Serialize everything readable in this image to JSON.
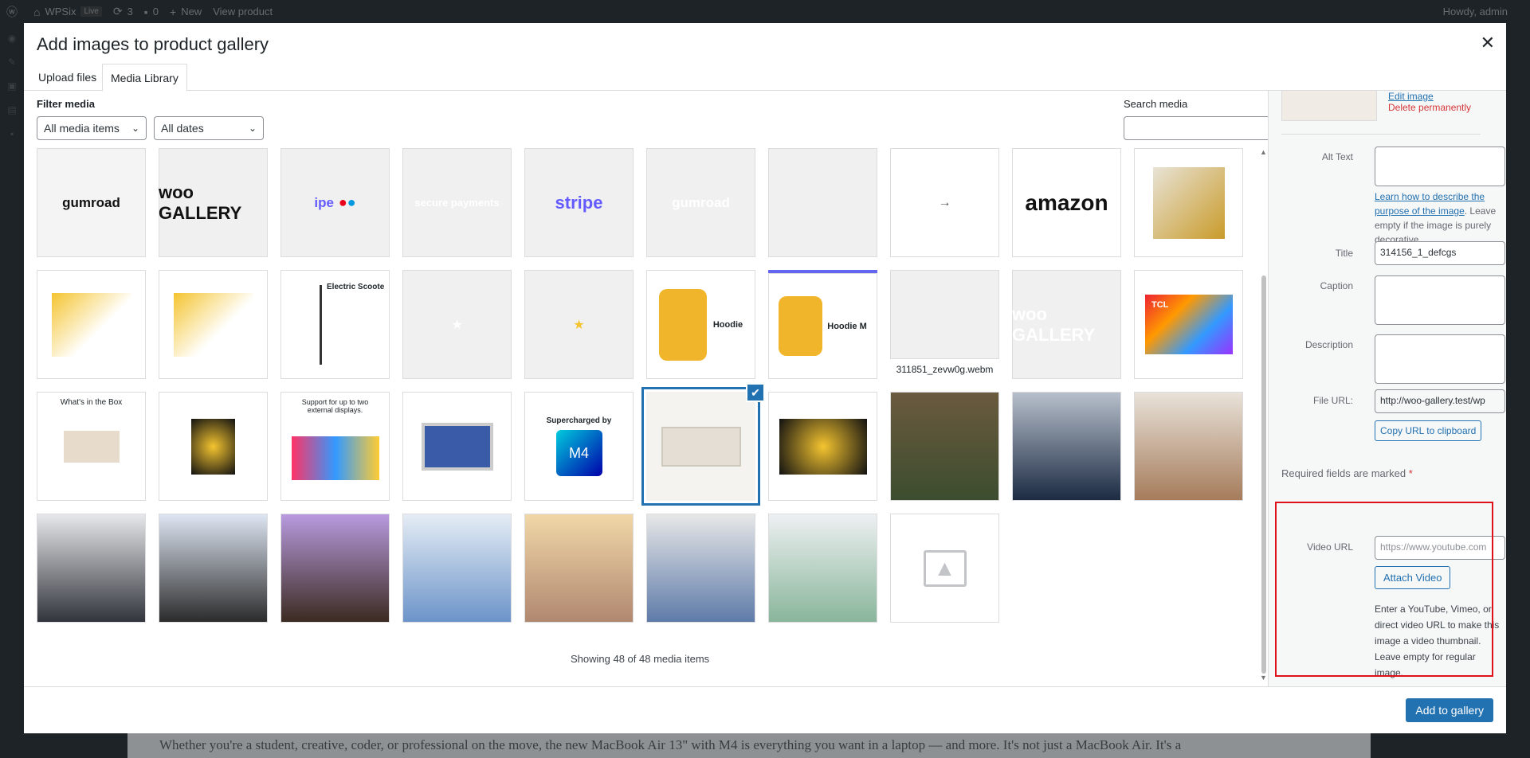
{
  "adminbar": {
    "site": "WPSix",
    "live": "Live",
    "updates": "3",
    "comments": "0",
    "new": "New",
    "view_product": "View product",
    "howdy": "Howdy, admin"
  },
  "modal": {
    "title": "Add images to product gallery",
    "tabs": [
      {
        "label": "Upload files"
      },
      {
        "label": "Media Library"
      }
    ],
    "filter_label": "Filter media",
    "filter_type": "All media items",
    "filter_date": "All dates",
    "search_label": "Search media",
    "showing": "Showing 48 of 48 media items",
    "tile_caption": "311851_zevw0g.webm",
    "primary_button": "Add to gallery"
  },
  "tiles": {
    "t0": "gumroad",
    "t1": "woo GALLERY",
    "t2": "ipe",
    "t3": "secure payments",
    "t4": "stripe",
    "t5": "gumroad",
    "t9": "amazon",
    "t16": "Hoodie",
    "t18": "Hoodie M",
    "t20": "woo GALLERY",
    "t22": "What's in the Box",
    "t24": "Support for up to two external displays.",
    "t26": "Supercharged by",
    "t26b": "M4",
    "t13": "Electric Scoote",
    "t21": "TCL"
  },
  "sidebar": {
    "edit_image": "Edit image",
    "delete": "Delete permanently",
    "alt_text_label": "Alt Text",
    "alt_help_link": "Learn how to describe the purpose of the image",
    "alt_help_rest": ". Leave empty if the image is purely decorative.",
    "title_label": "Title",
    "title_value": "314156_1_defcgs",
    "caption_label": "Caption",
    "description_label": "Description",
    "file_url_label": "File URL:",
    "file_url_value": "http://woo-gallery.test/wp",
    "copy_url": "Copy URL to clipboard",
    "required": "Required fields are marked",
    "required_star": "*",
    "video_url_label": "Video URL",
    "video_url_placeholder": "https://www.youtube.com",
    "attach_video": "Attach Video",
    "video_help": "Enter a YouTube, Vimeo, or direct video URL to make this image a video thumbnail. Leave empty for regular image."
  },
  "behind_text": "Whether you're a student, creative, coder, or professional on the move, the new MacBook Air 13\" with M4 is everything you want in a laptop — and more. It's not just a MacBook Air. It's a",
  "colors": {
    "accent": "#2271b1",
    "danger": "#d63638",
    "highlight": "#e0101a"
  }
}
